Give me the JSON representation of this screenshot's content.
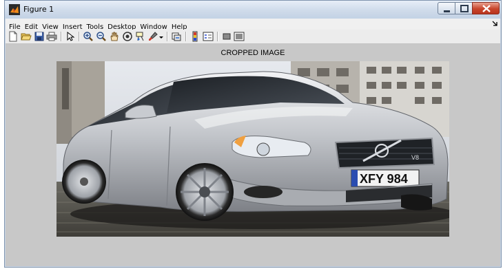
{
  "window": {
    "title": "Figure 1"
  },
  "menu": {
    "items": [
      "File",
      "Edit",
      "View",
      "Insert",
      "Tools",
      "Desktop",
      "Window",
      "Help"
    ]
  },
  "toolbar": {
    "icons": [
      "new-figure-icon",
      "open-file-icon",
      "save-icon",
      "print-icon",
      "edit-plot-arrow-icon",
      "zoom-in-icon",
      "zoom-out-icon",
      "pan-hand-icon",
      "rotate-3d-icon",
      "data-cursor-icon",
      "brush-icon",
      "link-plot-icon",
      "colorbar-icon",
      "legend-icon",
      "hide-plot-tools-icon",
      "show-plot-tools-icon"
    ]
  },
  "axes": {
    "title": "CROPPED IMAGE"
  },
  "image": {
    "plate_text": "XFY 984",
    "badge_text": "V8"
  },
  "colors": {
    "figure_bg": "#c8c8c8",
    "titlebar": "#cfdbea",
    "close_button": "#c8452c"
  }
}
